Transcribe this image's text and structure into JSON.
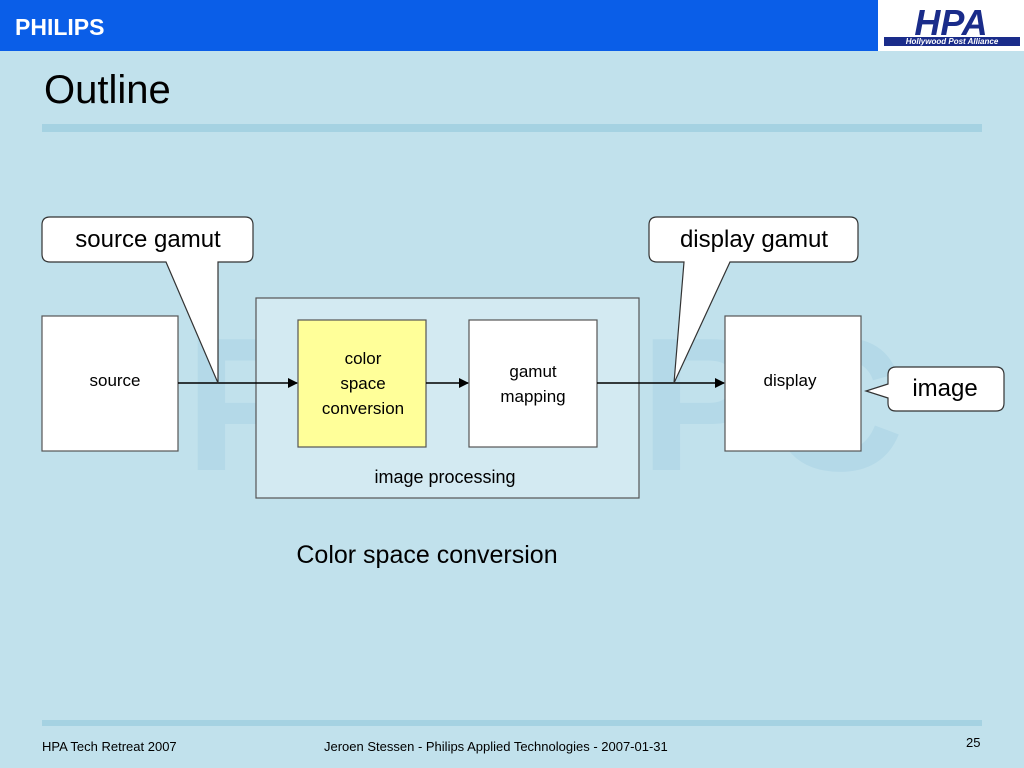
{
  "header": {
    "brand": "PHILIPS",
    "logo_text": "HPA",
    "logo_subtext": "Hollywood Post Alliance"
  },
  "slide": {
    "title": "Outline",
    "caption": "Color space conversion"
  },
  "diagram": {
    "callouts": {
      "source_gamut": "source gamut",
      "display_gamut": "display gamut",
      "image": "image"
    },
    "blocks": {
      "source": "source",
      "color_space_line1": "color",
      "color_space_line2": "space",
      "color_space_line3": "conversion",
      "gamut_line1": "gamut",
      "gamut_line2": "mapping",
      "display": "display",
      "image_processing": "image processing"
    }
  },
  "footer": {
    "event": "HPA Tech Retreat 2007",
    "author": "Jeroen Stessen - Philips Applied Technologies - 2007-01-31",
    "page_number": "25"
  },
  "colors": {
    "background": "#c1e1ec",
    "header_blue": "#0a5ee8",
    "highlight_yellow": "#ffff99",
    "group_fill": "#d3eaf2",
    "watermark": "#b4d9e8"
  }
}
